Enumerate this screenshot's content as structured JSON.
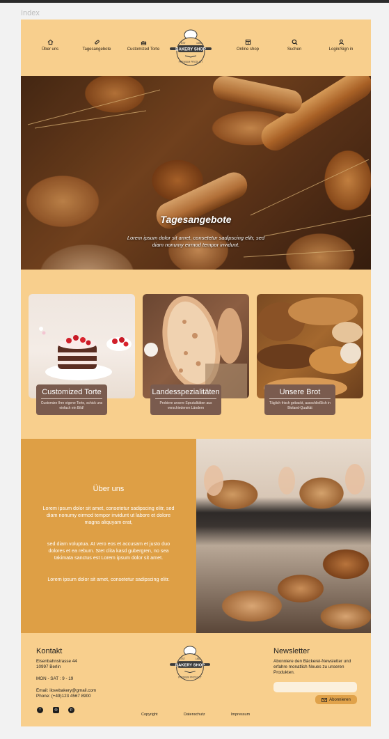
{
  "frame_label": "Index",
  "nav": {
    "left": [
      {
        "label": "Über uns",
        "icon": "home-icon"
      },
      {
        "label": "Tagesangebote",
        "icon": "bread-icon"
      },
      {
        "label": "Customized Torte",
        "icon": "cake-icon"
      }
    ],
    "right": [
      {
        "label": "Online shop",
        "icon": "shop-icon"
      },
      {
        "label": "Suchen",
        "icon": "search-icon"
      },
      {
        "label": "Login/Sign in",
        "icon": "user-icon"
      }
    ]
  },
  "logo": {
    "name": "BAKERY SHOP",
    "est": "EST",
    "year": "1850",
    "tagline": "PREMIUM PRODUCT"
  },
  "hero": {
    "title": "Tagesangebote",
    "subtitle": "Lorem ipsum dolor sit amet, consetetur sadipscing elitr, sed diam nonumy eirmod tempor invidunt."
  },
  "cards": [
    {
      "title": "Customized Torte",
      "desc": "Customize Ihre eigene Torte, schick uns einfach ein Bild!"
    },
    {
      "title": "Landesspezialitäten",
      "desc": "Probiere unsere Spezialitäten aus verschiedenen Ländern"
    },
    {
      "title": "Unsere Brot",
      "desc": "Täglich frisch gebackt, ausschließlich in Bioland-Qualität"
    }
  ],
  "about": {
    "title": "Über uns",
    "p1": "Lorem ipsum dolor sit amet, consetetur sadipscing elitr, sed diam nonumy eirmod tempor invidunt ut labore et dolore magna aliquyam erat,",
    "p2": "sed diam voluptua. At vero eos et accusam et justo duo dolores et ea rebum. Stet clita kasd gubergren, no sea takimata sanctus est Lorem ipsum dolor sit amet.",
    "p3": "Lorem ipsum dolor sit amet, consetetur sadipscing elitr."
  },
  "footer": {
    "contact_title": "Kontakt",
    "address_1": "Eisenbahnstrasse 44",
    "address_2": "10997 Berlin",
    "hours": "MON - SAT : 9 - 19",
    "email": "Email: ilovebakery@gmail.com",
    "phone": "Phone: (+49)123 4567 8900",
    "social": [
      "facebook-icon",
      "instagram-icon",
      "pinterest-icon"
    ],
    "newsletter_title": "Newsletter",
    "newsletter_text": "Abonniere den Bäckerei-Newsletter und erfahre monatlich Neues zu unseren Produkten.",
    "newsletter_placeholder": "",
    "subscribe_label": "Abonnieren",
    "links": [
      "Copyright",
      "Datenschutz",
      "Impressum"
    ]
  },
  "colors": {
    "page_bg": "#f8cf8d",
    "about_bg": "#de9f45",
    "card_label_bg": "#7a5b4e",
    "button_bg": "#e0a24a"
  }
}
